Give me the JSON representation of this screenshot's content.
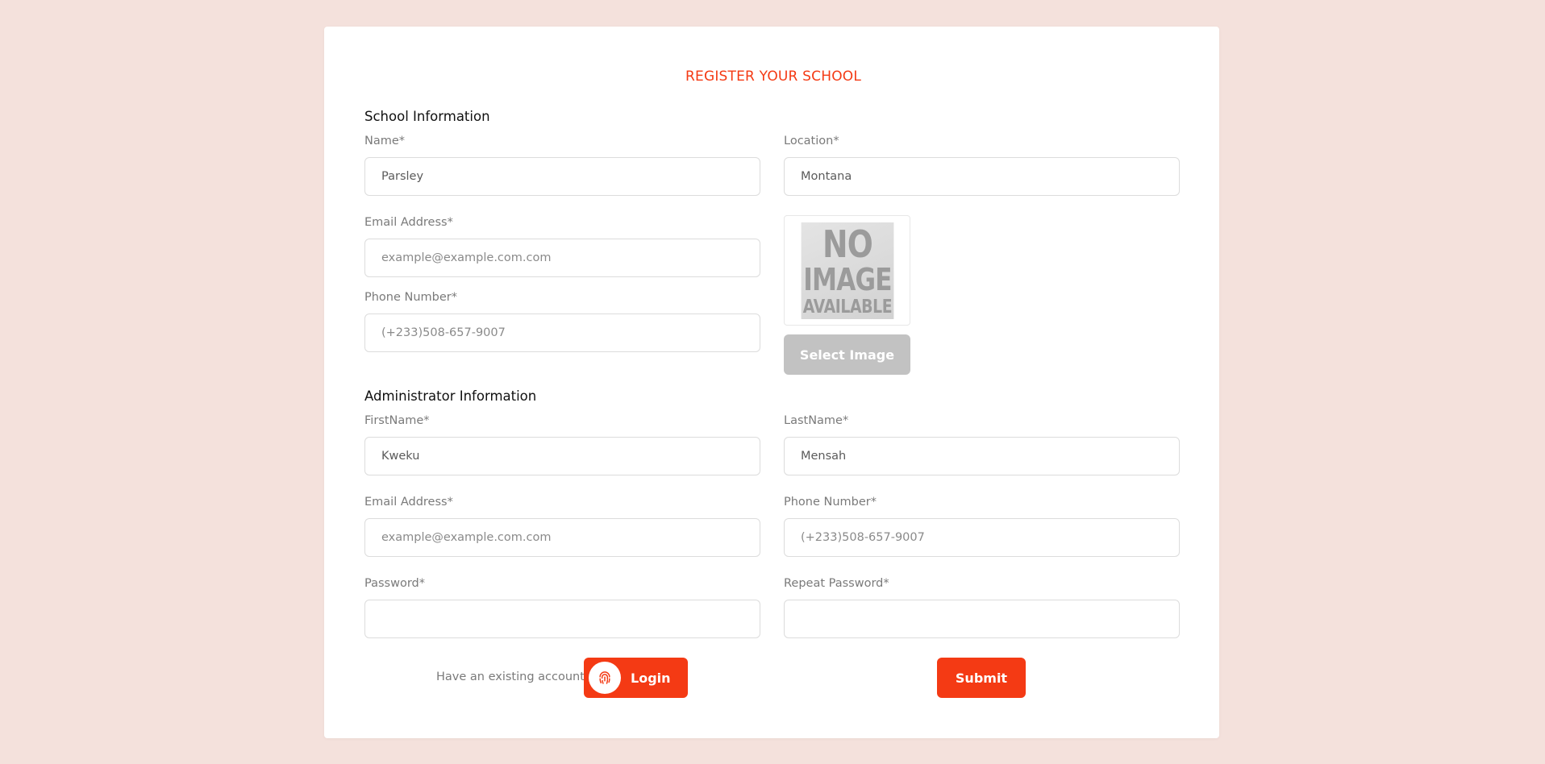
{
  "page_title": "REGISTER YOUR SCHOOL",
  "school_section": {
    "title": "School Information",
    "name": {
      "label": "Name*",
      "value": "Parsley"
    },
    "location": {
      "label": "Location*",
      "value": "Montana"
    },
    "email": {
      "label": "Email Address*",
      "placeholder": "example@example.com.com"
    },
    "phone": {
      "label": "Phone Number*",
      "placeholder": "(+233)508-657-9007"
    },
    "image": {
      "placeholder_line1": "NO",
      "placeholder_line2": "IMAGE",
      "placeholder_line3": "AVAILABLE",
      "select_label": "Select Image"
    }
  },
  "admin_section": {
    "title": "Administrator Information",
    "first_name": {
      "label": "FirstName*",
      "value": "Kweku"
    },
    "last_name": {
      "label": "LastName*",
      "value": "Mensah"
    },
    "email": {
      "label": "Email Address*",
      "placeholder": "example@example.com.com"
    },
    "phone": {
      "label": "Phone Number*",
      "placeholder": "(+233)508-657-9007"
    },
    "password": {
      "label": "Password*",
      "value": ""
    },
    "repeat_password": {
      "label": "Repeat Password*",
      "value": ""
    }
  },
  "footer": {
    "existing_account_text": "Have an existing account,",
    "login_label": "Login",
    "login_icon": "fingerprint-icon",
    "submit_label": "Submit"
  },
  "colors": {
    "accent": "#f43a14",
    "background": "#f4e1dc",
    "disabled_button": "#c2c2c2"
  }
}
